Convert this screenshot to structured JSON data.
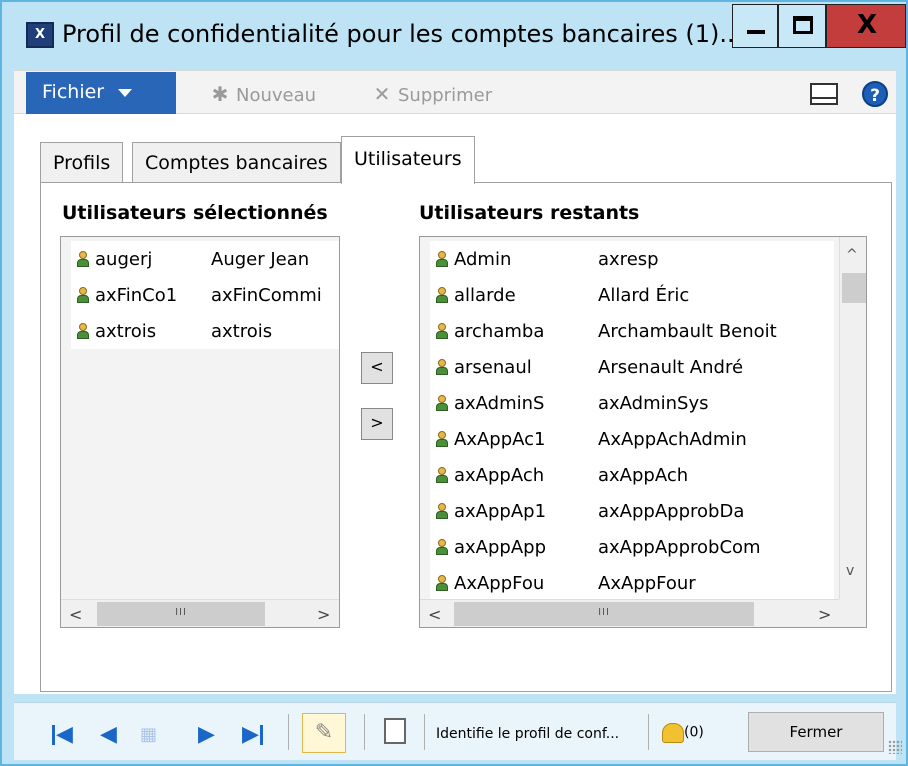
{
  "window": {
    "title": "Profil de confidentialité pour les comptes bancaires (1)...",
    "app_icon_label": "X",
    "minimize_label": "_",
    "close_label": "X"
  },
  "toolbar": {
    "file_label": "Fichier",
    "new_label": "Nouveau",
    "new_icon": "✱",
    "delete_label": "Supprimer",
    "delete_icon": "✕",
    "help_label": "?"
  },
  "tabs": [
    {
      "label": "Profils",
      "active": false
    },
    {
      "label": "Comptes bancaires",
      "active": false
    },
    {
      "label": "Utilisateurs",
      "active": true
    }
  ],
  "selected_users": {
    "label": "Utilisateurs sélectionnés",
    "rows": [
      {
        "id": "augerj",
        "name": "Auger Jean"
      },
      {
        "id": "axFinCo1",
        "name": "axFinCommi"
      },
      {
        "id": "axtrois",
        "name": "axtrois"
      }
    ]
  },
  "remaining_users": {
    "label": "Utilisateurs restants",
    "rows": [
      {
        "id": "Admin",
        "name": "axresp"
      },
      {
        "id": "allarde",
        "name": "Allard Éric"
      },
      {
        "id": "archamba",
        "name": "Archambault Benoit"
      },
      {
        "id": "arsenaul",
        "name": "Arsenault André"
      },
      {
        "id": "axAdminS",
        "name": "axAdminSys"
      },
      {
        "id": "AxAppAc1",
        "name": "AxAppAchAdmin"
      },
      {
        "id": "axAppAch",
        "name": "axAppAch"
      },
      {
        "id": "axAppAp1",
        "name": "axAppApprobDa"
      },
      {
        "id": "axAppApp",
        "name": "axAppApprobCom"
      },
      {
        "id": "AxAppFou",
        "name": "AxAppFour"
      }
    ]
  },
  "move": {
    "left_label": "<",
    "right_label": ">"
  },
  "scroll": {
    "up": "^",
    "down": "v",
    "left": "<",
    "right": ">",
    "thumb": "III"
  },
  "statusbar": {
    "nav_first": "◀",
    "nav_prev": "◀",
    "nav_list": "▦",
    "nav_next": "▶",
    "nav_last": "▶",
    "edit_icon": "✎",
    "attach_icon": "📋",
    "status_text": "Identifie le profil de conf...",
    "notification_count": "(0)",
    "close_label": "Fermer"
  },
  "colors": {
    "window_frame": "#bde3f5",
    "file_button": "#2a66b8",
    "nav_blue": "#1a67c8",
    "close_button": "#c43d3d"
  }
}
